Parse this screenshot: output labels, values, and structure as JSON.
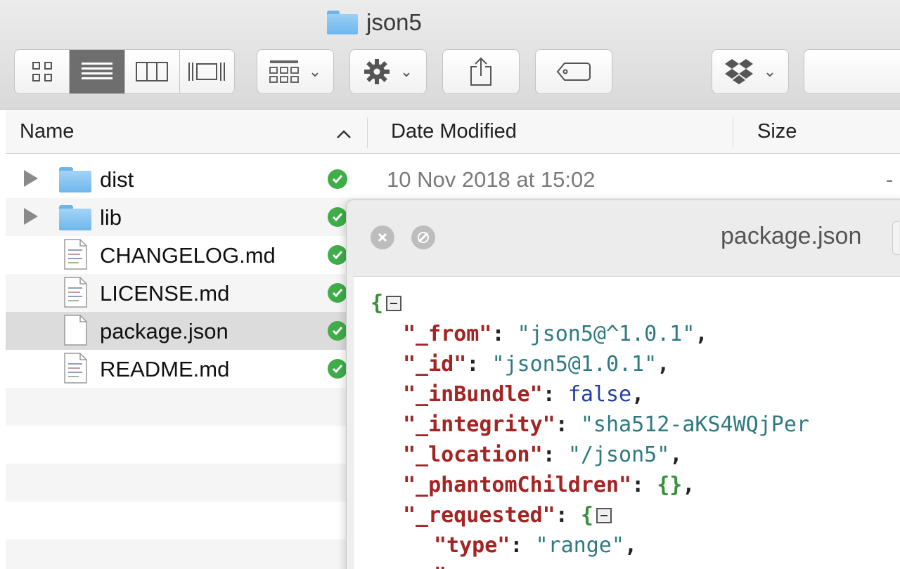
{
  "window": {
    "title": "json5"
  },
  "toolbar": {
    "view_modes": [
      "icon-view",
      "list-view",
      "column-view",
      "gallery-view"
    ],
    "active_view": "list-view",
    "buttons": [
      "group-by",
      "action-gear",
      "share",
      "tags",
      "dropbox"
    ]
  },
  "columns": {
    "name": "Name",
    "date_modified": "Date Modified",
    "size": "Size",
    "sort_indicator": "^"
  },
  "files": [
    {
      "name": "dist",
      "type": "folder",
      "date": "10 Nov 2018 at 15:02",
      "size": "-"
    },
    {
      "name": "lib",
      "type": "folder"
    },
    {
      "name": "CHANGELOG.md",
      "type": "doc"
    },
    {
      "name": "LICENSE.md",
      "type": "doc"
    },
    {
      "name": "package.json",
      "type": "blank",
      "selected": true
    },
    {
      "name": "README.md",
      "type": "doc"
    }
  ],
  "preview": {
    "title": "package.json",
    "lines": [
      {
        "key": "\"_from\"",
        "value": "\"json5@^1.0.1\"",
        "value_type": "string",
        "trail": ","
      },
      {
        "key": "\"_id\"",
        "value": "\"json5@1.0.1\"",
        "value_type": "string",
        "trail": ","
      },
      {
        "key": "\"_inBundle\"",
        "value": "false",
        "value_type": "bool",
        "trail": ","
      },
      {
        "key": "\"_integrity\"",
        "value": "\"sha512-aKS4WQjPer",
        "value_type": "string",
        "trail": ""
      },
      {
        "key": "\"_location\"",
        "value": "\"/json5\"",
        "value_type": "string",
        "trail": ","
      },
      {
        "key": "\"_phantomChildren\"",
        "value": "{}",
        "value_type": "object",
        "trail": ","
      },
      {
        "key": "\"_requested\"",
        "value": "{",
        "value_type": "object-open",
        "trail": ""
      },
      {
        "key": "\"type\"",
        "value": "\"range\"",
        "value_type": "string",
        "trail": ","
      }
    ]
  },
  "colors": {
    "check_green": "#3fae49",
    "json_key": "#a42323",
    "json_string": "#2e7a80",
    "json_bool": "#1f3fa8",
    "json_brace": "#3a8f3a"
  }
}
